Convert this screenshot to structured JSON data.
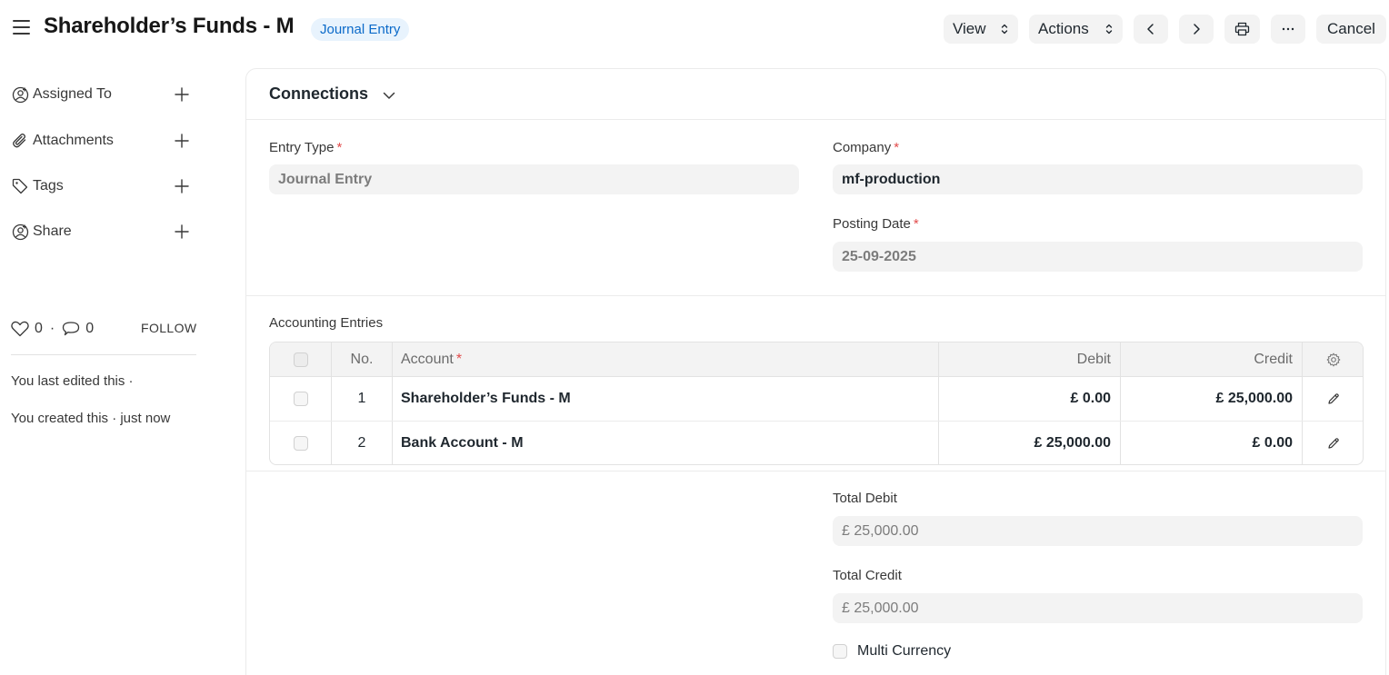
{
  "header": {
    "title": "Shareholder’s Funds - M",
    "doc_type_badge": "Journal Entry",
    "view_label": "View",
    "actions_label": "Actions",
    "cancel_label": "Cancel"
  },
  "sidebar": {
    "items": [
      {
        "label": "Assigned To",
        "icon": "assign-user-icon"
      },
      {
        "label": "Attachments",
        "icon": "paperclip-icon"
      },
      {
        "label": "Tags",
        "icon": "tag-icon"
      },
      {
        "label": "Share",
        "icon": "share-user-icon"
      }
    ],
    "likes_count": "0",
    "comments_count": "0",
    "follow_label": "FOLLOW",
    "activity": [
      "You last edited this ·",
      "You created this · just now"
    ]
  },
  "form": {
    "connections_label": "Connections",
    "entry_type": {
      "label": "Entry Type",
      "value": "Journal Entry",
      "required": "*"
    },
    "company": {
      "label": "Company",
      "value": "mf-production",
      "required": "*"
    },
    "posting_date": {
      "label": "Posting Date",
      "value": "25-09-2025",
      "required": "*"
    },
    "accounting_entries": {
      "section_label": "Accounting Entries",
      "columns": {
        "no": "No.",
        "account": "Account",
        "account_required": "*",
        "debit": "Debit",
        "credit": "Credit"
      },
      "rows": [
        {
          "no": "1",
          "account": "Shareholder’s Funds - M",
          "debit": "£ 0.00",
          "credit": "£ 25,000.00"
        },
        {
          "no": "2",
          "account": "Bank Account - M",
          "debit": "£ 25,000.00",
          "credit": "£ 0.00"
        }
      ]
    },
    "total_debit": {
      "label": "Total Debit",
      "value": "£ 25,000.00"
    },
    "total_credit": {
      "label": "Total Credit",
      "value": "£ 25,000.00"
    },
    "multi_currency": {
      "label": "Multi Currency"
    }
  },
  "colors": {
    "badge_bg": "#e8f3fd",
    "badge_text": "#0b6ac9",
    "required": "#e24c4c",
    "field_bg": "#f3f3f3"
  }
}
